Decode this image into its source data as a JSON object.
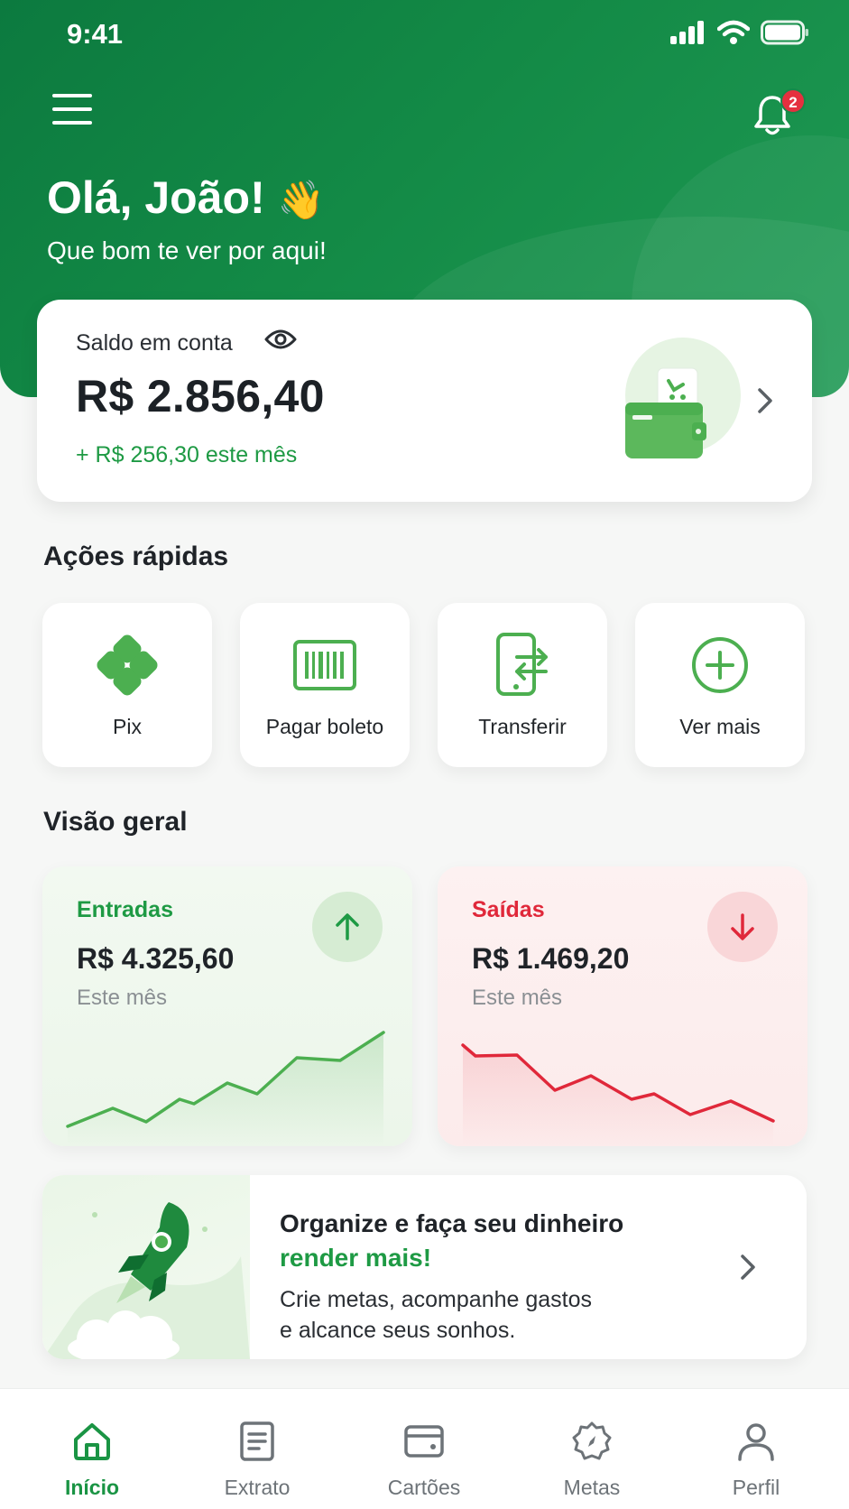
{
  "status_bar": {
    "time": "9:41"
  },
  "header": {
    "notification_count": "2",
    "greeting": "Olá, João!",
    "greeting_emoji": "👋",
    "subtitle": "Que bom te ver por aqui!"
  },
  "balance": {
    "label": "Saldo em conta",
    "value": "R$ 2.856,40",
    "change": "+ R$ 256,30 este mês"
  },
  "quick_actions": {
    "title": "Ações rápidas",
    "items": [
      {
        "label": "Pix",
        "icon": "pix-icon"
      },
      {
        "label": "Pagar boleto",
        "icon": "barcode-icon"
      },
      {
        "label": "Transferir",
        "icon": "transfer-phone-icon"
      },
      {
        "label": "Ver mais",
        "icon": "plus-circle-icon"
      }
    ]
  },
  "overview": {
    "title": "Visão geral",
    "income": {
      "title": "Entradas",
      "value": "R$ 4.325,60",
      "period": "Este mês",
      "color": "#1e9a44"
    },
    "expenses": {
      "title": "Saídas",
      "value": "R$ 1.469,20",
      "period": "Este mês",
      "color": "#e0283a"
    }
  },
  "promo": {
    "title_line1": "Organize e faça seu dinheiro",
    "title_line2": "render mais!",
    "body_line1": "Crie metas, acompanhe gastos",
    "body_line2": "e alcance seus sonhos."
  },
  "bottom_nav": {
    "items": [
      {
        "label": "Início",
        "icon": "home-icon",
        "active": true
      },
      {
        "label": "Extrato",
        "icon": "statement-icon",
        "active": false
      },
      {
        "label": "Cartões",
        "icon": "card-icon",
        "active": false
      },
      {
        "label": "Metas",
        "icon": "target-icon",
        "active": false
      },
      {
        "label": "Perfil",
        "icon": "profile-icon",
        "active": false
      }
    ]
  },
  "colors": {
    "brand": "#138a46",
    "accent": "#1e9a44",
    "danger": "#e0283a"
  }
}
